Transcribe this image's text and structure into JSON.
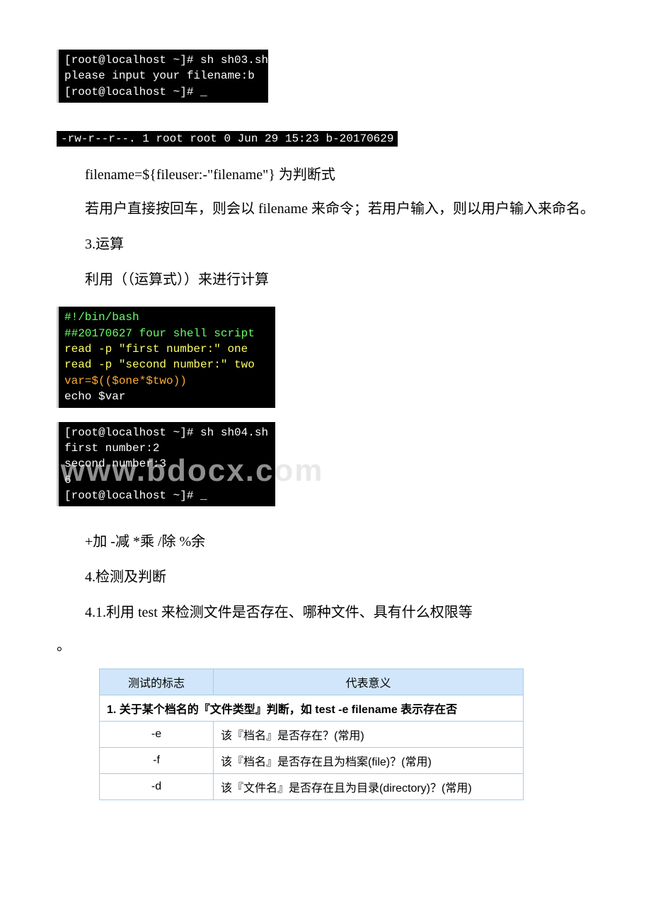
{
  "terminal1": "[root@localhost ~]# sh sh03.sh\nplease input your filename:b\n[root@localhost ~]# _",
  "lsOutput": "-rw-r--r--. 1 root root    0 Jun 29 15:23 b-20170629",
  "para_filename": "filename=${fileuser:-\"filename\"} 为判断式",
  "para_explain": "若用户直接按回车，则会以 filename 来命令；若用户输入，则以用户输入来命名。",
  "heading3": "3.运算",
  "para_calc": "利用（（运算式））来进行计算",
  "script_sh04_l1": "#!/bin/bash",
  "script_sh04_l2": "##20170627 four shell script",
  "script_sh04_l3": "read -p \"first number:\" one",
  "script_sh04_l4": "read -p \"second number:\" two",
  "script_sh04_l5": "var=$(($one*$two))",
  "script_sh04_l6": "echo $var",
  "run_sh04_l1": "[root@localhost ~]# sh sh04.sh",
  "run_sh04_l2": "first number:2",
  "run_sh04_l3": "second number:3",
  "run_sh04_l4": "6",
  "run_sh04_l5": "[root@localhost ~]# _",
  "watermark": "www.bdocx.com",
  "para_ops": "+加 -减 *乘 /除 %余",
  "heading4": " 4.检测及判断",
  "heading41": " 4.1.利用 test 来检测文件是否存在、哪种文件、具有什么权限等",
  "period_line": "。",
  "table": {
    "header_flag": "测试的标志",
    "header_meaning": "代表意义",
    "section1": "1. 关于某个档名的『文件类型』判断，如 test -e filename 表示存在否",
    "rows": [
      {
        "flag": "-e",
        "meaning": "该『档名』是否存在？(常用)"
      },
      {
        "flag": "-f",
        "meaning": "该『档名』是否存在且为档案(file)？(常用)"
      },
      {
        "flag": "-d",
        "meaning": "该『文件名』是否存在且为目录(directory)？(常用)"
      }
    ]
  }
}
